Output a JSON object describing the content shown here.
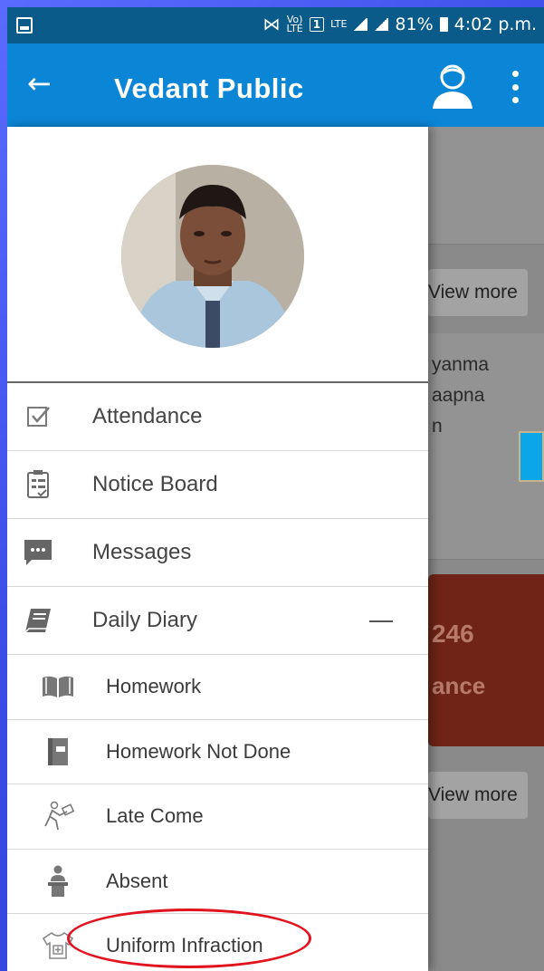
{
  "status_bar": {
    "volte": "Vo)",
    "lte_small": "LTE",
    "sim": "1",
    "lte": "LTE",
    "battery": "81%",
    "time": "4:02 p.m."
  },
  "app_bar": {
    "title": "Vedant Public",
    "back_icon": "arrow-left-icon",
    "profile_icon": "user-profile-icon",
    "more_icon": "more-vert-icon"
  },
  "drawer": {
    "menu": [
      {
        "label": "Attendance",
        "icon": "checkbox-icon"
      },
      {
        "label": "Notice Board",
        "icon": "checklist-icon"
      },
      {
        "label": "Messages",
        "icon": "chat-icon"
      },
      {
        "label": "Daily Diary",
        "icon": "book-icon",
        "expanded": true
      }
    ],
    "submenu": [
      {
        "label": "Homework",
        "icon": "open-book-icon"
      },
      {
        "label": "Homework Not Done",
        "icon": "notebook-icon"
      },
      {
        "label": "Late Come",
        "icon": "running-person-icon"
      },
      {
        "label": "Absent",
        "icon": "person-desk-icon"
      },
      {
        "label": "Uniform Infraction",
        "icon": "shirt-icon"
      }
    ]
  },
  "background": {
    "view_more_1": "View more",
    "text_line_1": "yanma",
    "text_line_2": "aapna",
    "text_line_3": "n",
    "card_number": "246",
    "card_label": "ance",
    "view_more_2": "View more"
  },
  "colors": {
    "app_bar": "#0b86d6",
    "status_bar": "#0a5a8a",
    "highlight": "#e0131e"
  }
}
